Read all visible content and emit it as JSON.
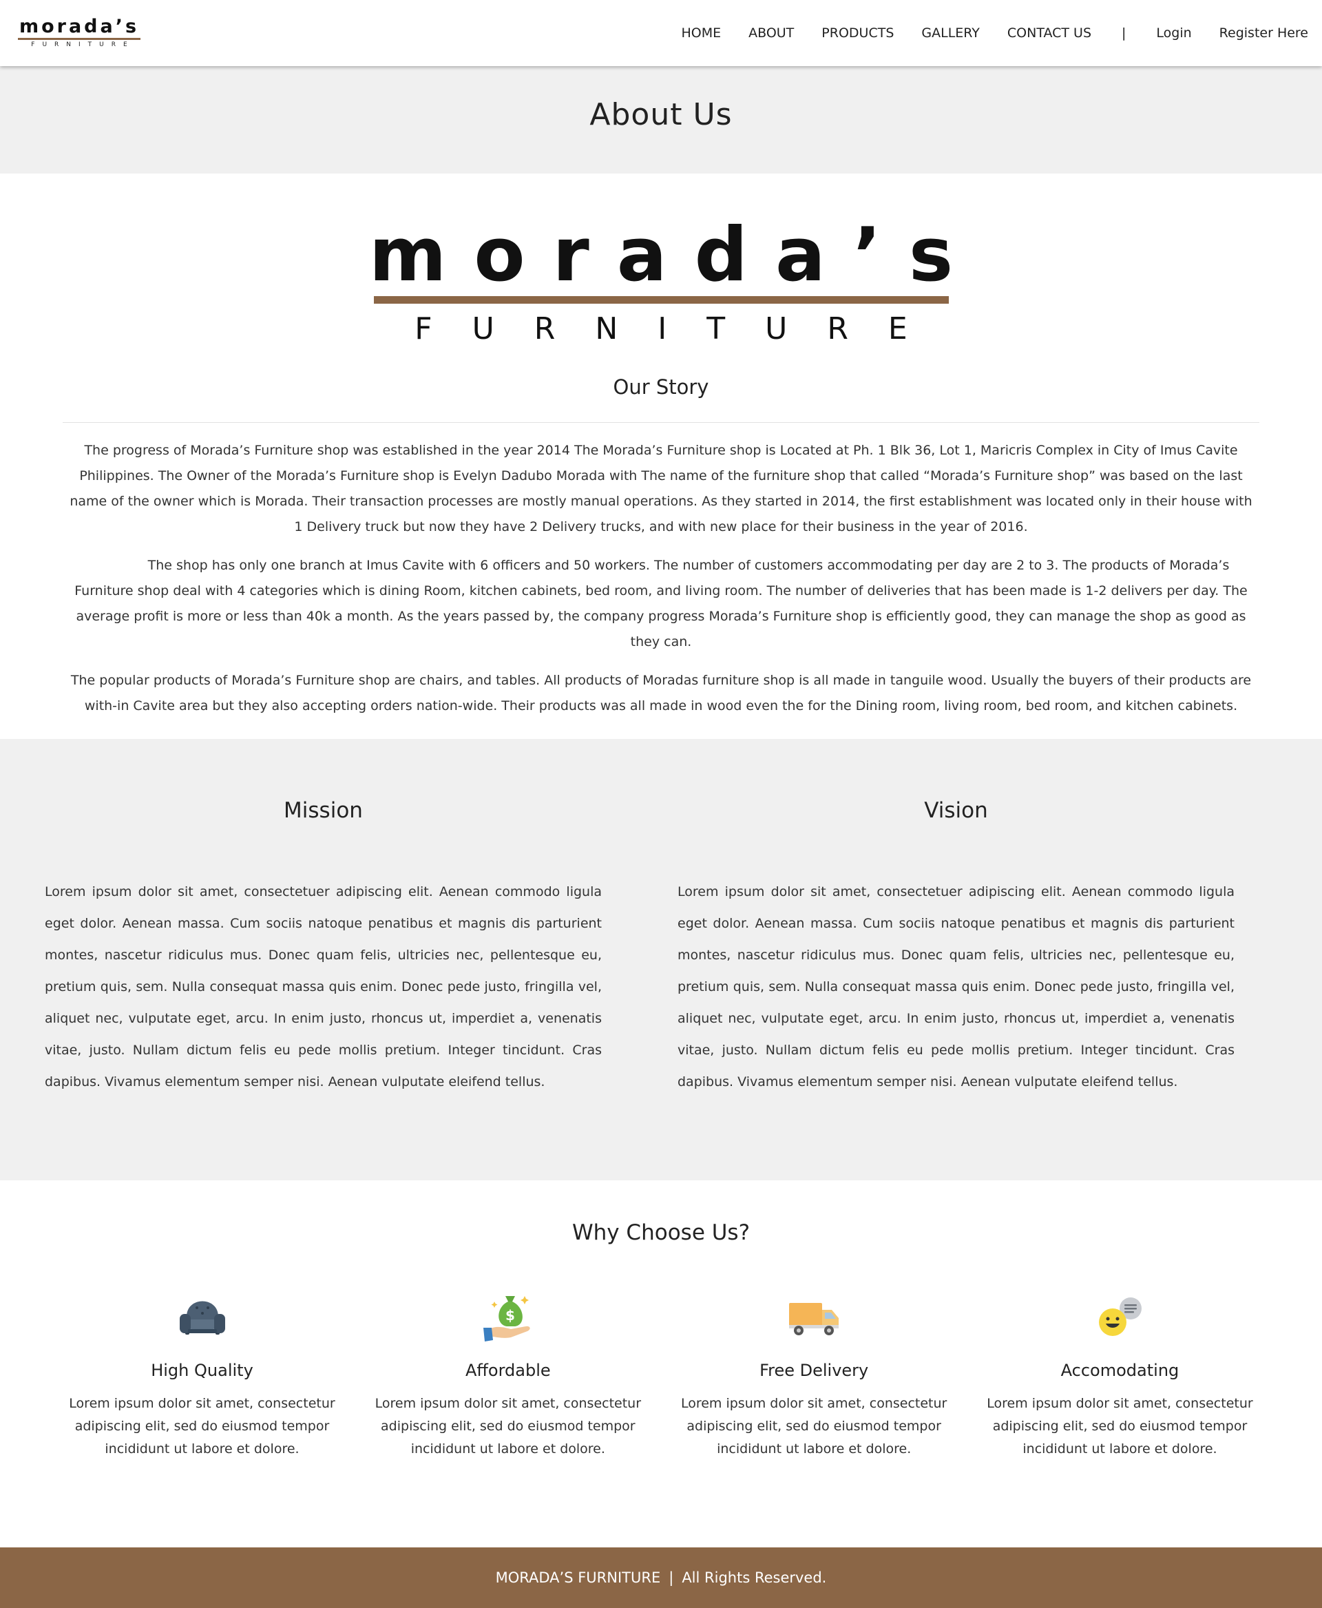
{
  "header": {
    "logo": {
      "brand": "morada’s",
      "sub": "FURNITURE"
    },
    "nav": [
      "HOME",
      "ABOUT",
      "PRODUCTS",
      "GALLERY",
      "CONTACT US"
    ],
    "separator": "|",
    "login": "Login",
    "register": "Register Here"
  },
  "banner": {
    "title": "About Us"
  },
  "story": {
    "logo": {
      "brand": "morada’s",
      "sub": "FURNITURE"
    },
    "heading": "Our Story",
    "paragraphs": [
      "The progress of Morada’s Furniture shop was established in the year 2014 The Morada’s Furniture shop is Located at Ph. 1 Blk 36, Lot 1, Maricris Complex in City of Imus Cavite Philippines. The Owner of the Morada’s Furniture shop is Evelyn Dadubo Morada with The name of the furniture shop that called “Morada’s Furniture shop” was based on the last name of the owner which is Morada. Their transaction processes are mostly manual operations. As they started in 2014, the first establishment was located only in their house with 1 Delivery truck but now they have 2 Delivery trucks, and with new place for their business in the year of 2016.",
      "The shop has only one branch at Imus Cavite with 6 officers and 50 workers. The number of customers accommodating per day are 2 to 3. The products of Morada’s Furniture shop deal with 4 categories which is dining Room, kitchen cabinets, bed room, and living room. The number of deliveries that has been made is 1-2 delivers per day. The average profit is more or less than 40k a month. As the years passed by, the company progress Morada’s Furniture shop is efficiently good, they can manage the shop as good as they can.",
      "The popular products of Morada’s Furniture shop are chairs, and tables. All products of Moradas furniture shop is all made in tanguile wood. Usually the buyers of their products are with-in Cavite area but they also accepting orders nation-wide. Their products was all made in wood even the for the Dining room, living room, bed room, and kitchen cabinets."
    ]
  },
  "mission": {
    "title": "Mission",
    "text": "Lorem ipsum dolor sit amet, consectetuer adipiscing elit. Aenean commodo ligula eget dolor. Aenean massa. Cum sociis natoque penatibus et magnis dis parturient montes, nascetur ridiculus mus. Donec quam felis, ultricies nec, pellentesque eu, pretium quis, sem. Nulla consequat massa quis enim. Donec pede justo, fringilla vel, aliquet nec, vulputate eget, arcu. In enim justo, rhoncus ut, imperdiet a, venenatis vitae, justo. Nullam dictum felis eu pede mollis pretium. Integer tincidunt. Cras dapibus. Vivamus elementum semper nisi. Aenean vulputate eleifend tellus."
  },
  "vision": {
    "title": "Vision",
    "text": "Lorem ipsum dolor sit amet, consectetuer adipiscing elit. Aenean commodo ligula eget dolor. Aenean massa. Cum sociis natoque penatibus et magnis dis parturient montes, nascetur ridiculus mus. Donec quam felis, ultricies nec, pellentesque eu, pretium quis, sem. Nulla consequat massa quis enim. Donec pede justo, fringilla vel, aliquet nec, vulputate eget, arcu. In enim justo, rhoncus ut, imperdiet a, venenatis vitae, justo. Nullam dictum felis eu pede mollis pretium. Integer tincidunt. Cras dapibus. Vivamus elementum semper nisi. Aenean vulputate eleifend tellus."
  },
  "why": {
    "heading": "Why Choose Us?",
    "features": [
      {
        "icon": "armchair-icon",
        "title": "High Quality",
        "text": "Lorem ipsum dolor sit amet, consectetur adipiscing elit, sed do eiusmod tempor incididunt ut labore et dolore."
      },
      {
        "icon": "money-bag-hand-icon",
        "title": "Affordable",
        "text": "Lorem ipsum dolor sit amet, consectetur adipiscing elit, sed do eiusmod tempor incididunt ut labore et dolore."
      },
      {
        "icon": "delivery-truck-icon",
        "title": "Free Delivery",
        "text": "Lorem ipsum dolor sit amet, consectetur adipiscing elit, sed do eiusmod tempor incididunt ut labore et dolore."
      },
      {
        "icon": "smiley-chat-icon",
        "title": "Accomodating",
        "text": "Lorem ipsum dolor sit amet, consectetur adipiscing elit, sed do eiusmod tempor incididunt ut labore et dolore."
      }
    ]
  },
  "footer": {
    "brand": "MORADA’S FURNITURE",
    "divider": "|",
    "rights": "All Rights Reserved."
  },
  "colors": {
    "accent": "#8b6646",
    "section_gray": "#f0f0f0",
    "text": "#222222"
  }
}
